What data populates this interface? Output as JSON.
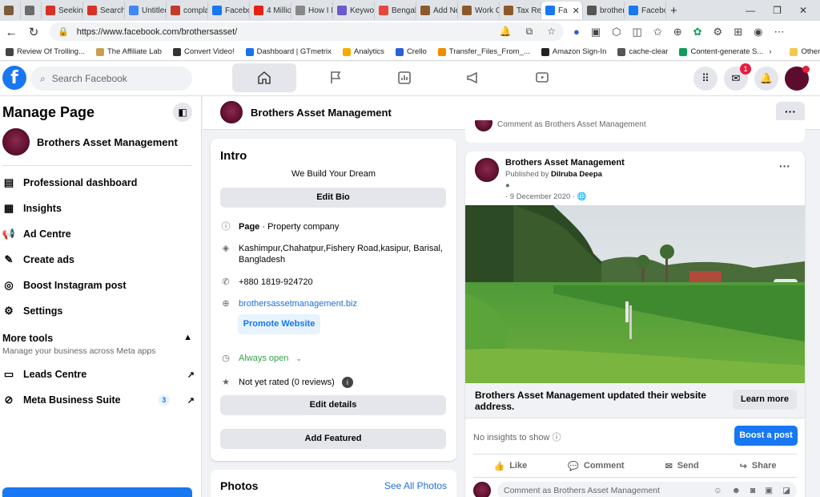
{
  "browser": {
    "tabs": [
      {
        "label": "",
        "color": "#7a5c3a"
      },
      {
        "label": "",
        "color": "#6b6b6b"
      },
      {
        "label": "Seeking",
        "color": "#d93025"
      },
      {
        "label": "Search",
        "color": "#d93025"
      },
      {
        "label": "Untitled",
        "color": "#4285f4"
      },
      {
        "label": "compla",
        "color": "#c53929"
      },
      {
        "label": "Facebo",
        "color": "#1877f2"
      },
      {
        "label": "4 Millio",
        "color": "#e62117"
      },
      {
        "label": "How I P",
        "color": "#888888"
      },
      {
        "label": "Keywor",
        "color": "#6a5acd"
      },
      {
        "label": "Bengali",
        "color": "#e8453c"
      },
      {
        "label": "Add Ne",
        "color": "#8b5a2b"
      },
      {
        "label": "Work C",
        "color": "#8b5a2b"
      },
      {
        "label": "Tax Ret",
        "color": "#8b5a2b"
      },
      {
        "label": "Fa",
        "color": "#1877f2",
        "active": true
      },
      {
        "label": "brother",
        "color": "#555555"
      },
      {
        "label": "Facebo",
        "color": "#1877f2"
      }
    ],
    "url": "https://www.facebook.com/brothersasset/",
    "bookmarks": [
      {
        "label": "Review Of Trolling...",
        "color": "#444444"
      },
      {
        "label": "The Affiliate Lab",
        "color": "#c8a050"
      },
      {
        "label": "Convert Video!",
        "color": "#333333"
      },
      {
        "label": "Dashboard | GTmetrix",
        "color": "#1a73e8"
      },
      {
        "label": "Analytics",
        "color": "#f9ab00"
      },
      {
        "label": "Crello",
        "color": "#2b5fd9"
      },
      {
        "label": "Transfer_Files_From_...",
        "color": "#f28b00"
      },
      {
        "label": "Amazon Sign-In",
        "color": "#222222"
      },
      {
        "label": "cache-clear",
        "color": "#555555"
      },
      {
        "label": "Content-generate S...",
        "color": "#0f9d58"
      }
    ],
    "other_favorites": "Other favorites"
  },
  "fb": {
    "search_placeholder": "Search Facebook",
    "messenger_badge": "1"
  },
  "sidebar": {
    "title": "Manage Page",
    "page_name": "Brothers Asset Management",
    "items": [
      {
        "label": "Professional dashboard",
        "icon": "dashboard-icon"
      },
      {
        "label": "Insights",
        "icon": "insights-icon"
      },
      {
        "label": "Ad Centre",
        "icon": "megaphone-icon"
      },
      {
        "label": "Create ads",
        "icon": "edit-icon"
      },
      {
        "label": "Boost Instagram post",
        "icon": "instagram-icon"
      },
      {
        "label": "Settings",
        "icon": "gear-icon"
      }
    ],
    "more_tools_title": "More tools",
    "more_tools_sub": "Manage your business across Meta apps",
    "tools": [
      {
        "label": "Leads Centre"
      },
      {
        "label": "Meta Business Suite",
        "badge": "3"
      }
    ]
  },
  "page_header": {
    "name": "Brothers Asset Management"
  },
  "intro": {
    "title": "Intro",
    "tagline": "We Build Your Dream",
    "edit_bio": "Edit Bio",
    "page_label": "Page",
    "category": " · Property company",
    "address": "Kashimpur,Chahatpur,Fishery Road,kasipur, Barisal, Bangladesh",
    "phone": "+880 1819-924720",
    "website": "brothersassetmanagement.biz",
    "promote": "Promote Website",
    "hours": "Always open",
    "rating": "Not yet rated (0 reviews)",
    "edit_details": "Edit details",
    "add_featured": "Add Featured"
  },
  "photos": {
    "title": "Photos",
    "see_all": "See All Photos"
  },
  "post": {
    "prev_comment": "Comment as Brothers Asset Management",
    "author": "Brothers Asset Management",
    "published_by_label": "Published by ",
    "published_by": "Dilruba Deepa",
    "date": "· 9 December 2020 ·",
    "link_text": "Brothers Asset Management updated their website address.",
    "learn_more": "Learn more",
    "insights": "No insights to show",
    "boost": "Boost a post",
    "like": "Like",
    "comment": "Comment",
    "send": "Send",
    "share": "Share",
    "comment_placeholder": "Comment as Brothers Asset Management"
  },
  "colors": {
    "accent": "#1877f2",
    "page_avatar": "#5c0d2e"
  }
}
